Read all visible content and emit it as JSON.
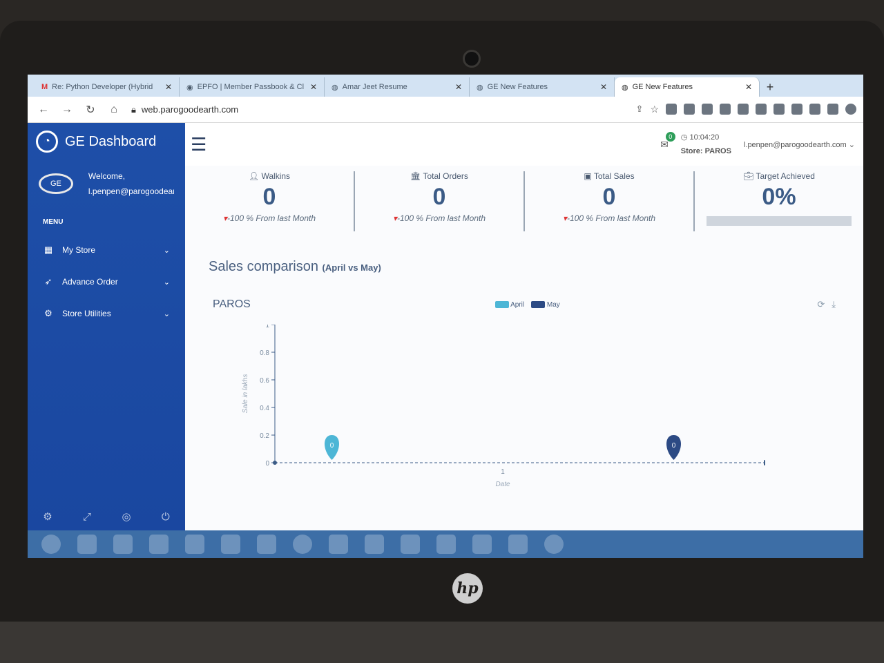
{
  "browser": {
    "tabs": [
      {
        "label": "Re: Python Developer (Hybrid",
        "active": false
      },
      {
        "label": "EPFO | Member Passbook & Cl",
        "active": false
      },
      {
        "label": "Amar Jeet Resume",
        "active": false
      },
      {
        "label": "GE New Features",
        "active": false
      },
      {
        "label": "GE New Features",
        "active": true
      }
    ],
    "url": "web.parogoodearth.com"
  },
  "sidebar": {
    "brand": "GE Dashboard",
    "welcome": "Welcome,",
    "user": "l.penpen@parogoodearth.com",
    "menu_heading": "MENU",
    "items": [
      {
        "label": "My Store",
        "icon": "grid-icon"
      },
      {
        "label": "Advance Order",
        "icon": "rocket-icon"
      },
      {
        "label": "Store Utilities",
        "icon": "gears-icon"
      }
    ]
  },
  "topbar": {
    "mail_count": "0",
    "time": "10:04:20",
    "store": "Store: PAROS",
    "user_email": "l.penpen@parogoodearth.com"
  },
  "kpis": [
    {
      "title": "Walkins",
      "icon": "user-icon",
      "value": "0",
      "change": "-100 % From last Month"
    },
    {
      "title": "Total Orders",
      "icon": "bank-icon",
      "value": "0",
      "change": "-100 % From last Month"
    },
    {
      "title": "Total Sales",
      "icon": "money-icon",
      "value": "0",
      "change": "-100 % From last Month"
    },
    {
      "title": "Target Achieved",
      "icon": "briefcase-icon",
      "value": "0%"
    }
  ],
  "section": {
    "title": "Sales comparison",
    "subtitle": "(April vs May)"
  },
  "chart_head": {
    "store": "PAROS"
  },
  "chart_data": {
    "type": "scatter",
    "series": [
      {
        "name": "April",
        "color": "#4db6d6",
        "points": [
          {
            "x": 0.25,
            "y": 0
          }
        ]
      },
      {
        "name": "May",
        "color": "#2c4a84",
        "points": [
          {
            "x": 1.75,
            "y": 0
          }
        ]
      }
    ],
    "marker_labels": [
      "0",
      "0"
    ],
    "x_ticks": [
      "1"
    ],
    "y_ticks": [
      "1",
      "0.8",
      "0.6",
      "0.4",
      "0.2",
      "0"
    ],
    "xlabel": "Date",
    "ylabel": "Sale in lakhs",
    "ylim": [
      0,
      1
    ],
    "xlim": [
      0,
      2
    ]
  }
}
